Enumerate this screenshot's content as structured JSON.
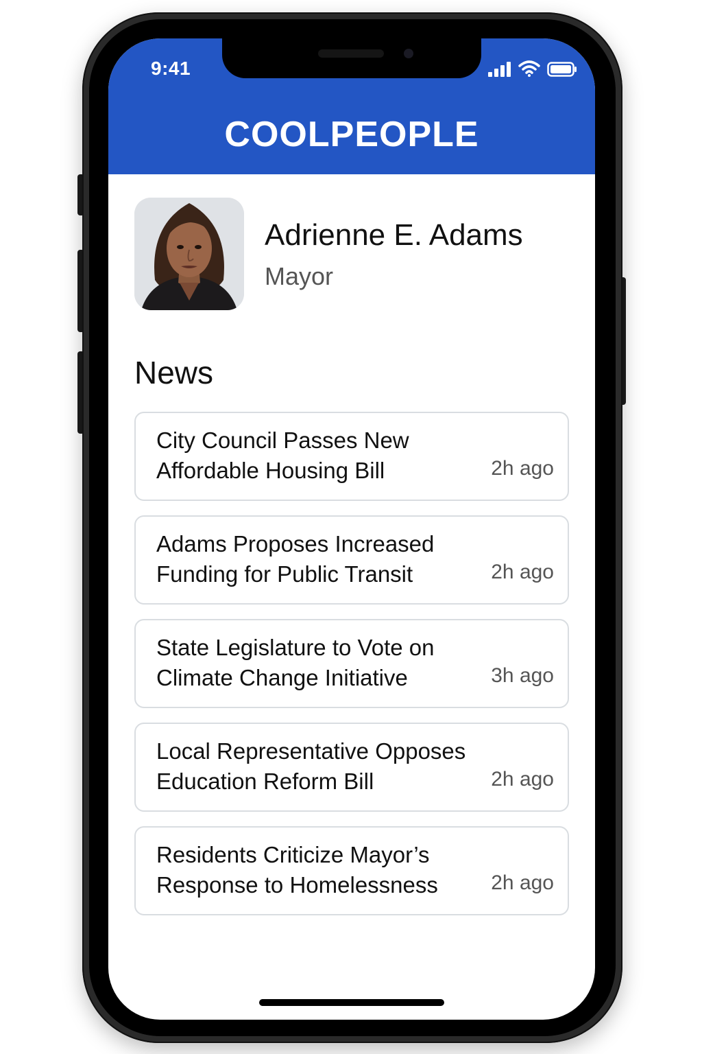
{
  "status_bar": {
    "time": "9:41",
    "icons": [
      "cellular-signal-icon",
      "wifi-icon",
      "battery-icon"
    ]
  },
  "header": {
    "app_title": "COOLPEOPLE",
    "background_color": "#2356c4"
  },
  "profile": {
    "name": "Adrienne E. Adams",
    "role": "Mayor"
  },
  "news": {
    "heading": "News",
    "items": [
      {
        "title": "City Council Passes New Affordable Housing Bill",
        "time": "2h ago"
      },
      {
        "title": "Adams Proposes Increased Funding for Public Transit",
        "time": "2h ago"
      },
      {
        "title": "State Legislature to Vote on Climate Change Initiative",
        "time": "3h ago"
      },
      {
        "title": "Local Representative Opposes Education Reform Bill",
        "time": "2h ago"
      },
      {
        "title": "Residents Criticize Mayor’s Response to Homelessness",
        "time": "2h ago"
      }
    ]
  }
}
